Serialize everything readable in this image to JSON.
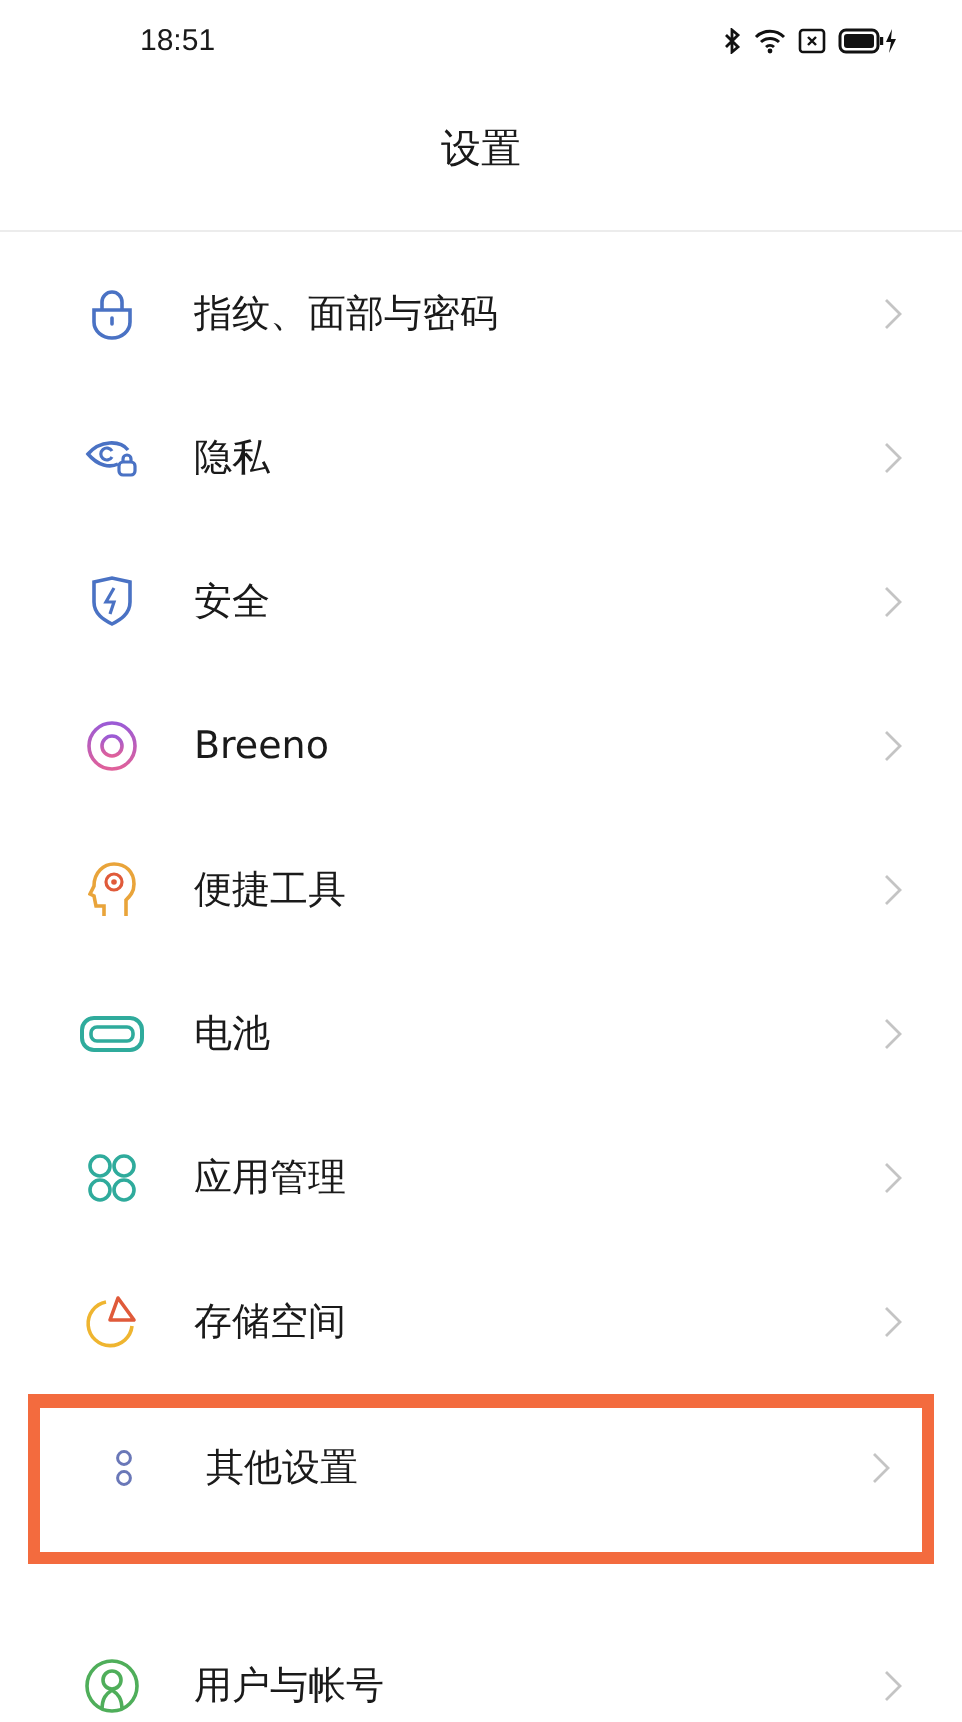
{
  "status_bar": {
    "time": "18:51",
    "charging": true
  },
  "title": "设置",
  "items": [
    {
      "kind": "lock",
      "label": "指纹、面部与密码",
      "highlighted": false
    },
    {
      "kind": "eye",
      "label": "隐私",
      "highlighted": false
    },
    {
      "kind": "shield",
      "label": "安全",
      "highlighted": false
    },
    {
      "kind": "ring",
      "label": "Breeno",
      "highlighted": false
    },
    {
      "kind": "head",
      "label": "便捷工具",
      "highlighted": false
    },
    {
      "kind": "battery",
      "label": "电池",
      "highlighted": false
    },
    {
      "kind": "apps",
      "label": "应用管理",
      "highlighted": false
    },
    {
      "kind": "pie",
      "label": "存储空间",
      "highlighted": false
    },
    {
      "kind": "dots",
      "label": "其他设置",
      "highlighted": true
    },
    {
      "kind": "user",
      "label": "用户与帐号",
      "highlighted": false
    }
  ]
}
